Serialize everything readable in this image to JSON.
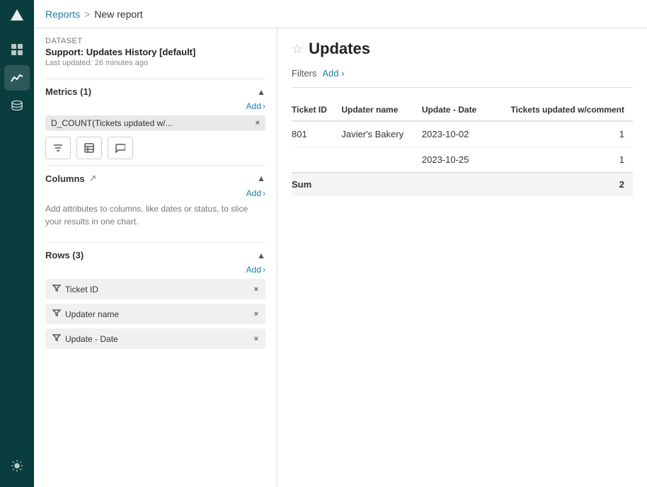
{
  "sidebar": {
    "logo_alt": "logo",
    "items": [
      {
        "id": "home",
        "icon": "▲",
        "label": "Home",
        "active": false
      },
      {
        "id": "dashboard",
        "icon": "⊞",
        "label": "Dashboard",
        "active": false
      },
      {
        "id": "reports",
        "icon": "📈",
        "label": "Reports",
        "active": true
      },
      {
        "id": "database",
        "icon": "🗄",
        "label": "Database",
        "active": false
      },
      {
        "id": "settings",
        "icon": "⚙",
        "label": "Settings",
        "active": false
      }
    ]
  },
  "breadcrumb": {
    "parent": "Reports",
    "separator": ">",
    "current": "New report"
  },
  "left_panel": {
    "dataset": {
      "label": "Dataset",
      "name": "Support: Updates History [default]",
      "updated": "Last updated: 26 minutes ago"
    },
    "metrics": {
      "title": "Metrics (1)",
      "add_label": "Add",
      "chip": {
        "text": "D_COUNT(Tickets updated w/...",
        "close": "×"
      },
      "chart_icons": [
        {
          "id": "filter-icon",
          "symbol": "◇"
        },
        {
          "id": "table-icon",
          "symbol": "⊞"
        },
        {
          "id": "chat-icon",
          "symbol": "💬"
        }
      ]
    },
    "columns": {
      "title": "Columns",
      "add_label": "Add",
      "hint": "Add attributes to columns, like dates or status, to slice your results in one chart."
    },
    "rows": {
      "title": "Rows (3)",
      "add_label": "Add",
      "items": [
        {
          "label": "Ticket ID",
          "close": "×"
        },
        {
          "label": "Updater name",
          "close": "×"
        },
        {
          "label": "Update - Date",
          "close": "×"
        }
      ]
    }
  },
  "right_panel": {
    "title": "Updates",
    "star_label": "★",
    "filters": {
      "label": "Filters",
      "add_label": "Add ›"
    },
    "table": {
      "columns": [
        "Ticket ID",
        "Updater name",
        "Update - Date",
        "Tickets updated w/comment"
      ],
      "rows": [
        {
          "ticket_id": "801",
          "updater_name": "Javier's Bakery",
          "update_date": "2023-10-02",
          "count": "1"
        },
        {
          "ticket_id": "",
          "updater_name": "",
          "update_date": "2023-10-25",
          "count": "1"
        }
      ],
      "sum": {
        "label": "Sum",
        "value": "2"
      }
    }
  }
}
